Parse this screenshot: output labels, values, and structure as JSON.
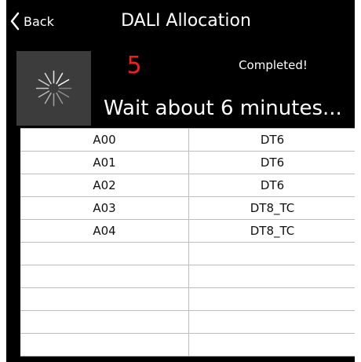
{
  "header": {
    "back_label": "Back",
    "title": "DALI Allocation"
  },
  "progress": {
    "count": "5",
    "status": "Completed!",
    "wait_message": "Wait about 6 minutes..."
  },
  "colors": {
    "background": "#000000",
    "count": "#ff1a1a",
    "spinner_box": "#3c3c3c",
    "table_background": "#ffffff"
  },
  "icons": {
    "back": "chevron-left-icon",
    "spinner": "loading-spinner-icon"
  },
  "table": {
    "rows": [
      [
        "A00",
        "DT6"
      ],
      [
        "A01",
        "DT6"
      ],
      [
        "A02",
        "DT6"
      ],
      [
        "A03",
        "DT8_TC"
      ],
      [
        "A04",
        "DT8_TC"
      ],
      [
        "",
        ""
      ],
      [
        "",
        ""
      ],
      [
        "",
        ""
      ],
      [
        "",
        ""
      ],
      [
        "",
        ""
      ]
    ]
  }
}
